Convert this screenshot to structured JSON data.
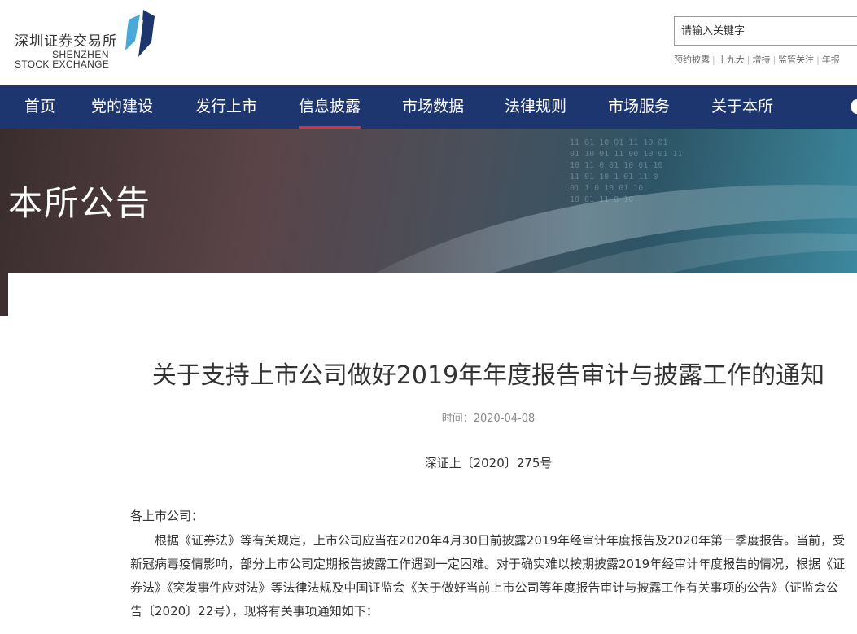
{
  "header": {
    "logo_cn": "深圳证券交易所",
    "logo_en_1": "SHENZHEN",
    "logo_en_2": "STOCK EXCHANGE",
    "search_placeholder": "请输入关键字",
    "quick_links": [
      "预约披露",
      "十九大",
      "增持",
      "监管关注",
      "年报"
    ]
  },
  "nav": {
    "items": [
      {
        "label": "首页"
      },
      {
        "label": "党的建设"
      },
      {
        "label": "发行上市"
      },
      {
        "label": "信息披露",
        "active": true
      },
      {
        "label": "市场数据"
      },
      {
        "label": "法律规则"
      },
      {
        "label": "市场服务"
      },
      {
        "label": "关于本所"
      }
    ]
  },
  "banner": {
    "title": "本所公告"
  },
  "article": {
    "title": "关于支持上市公司做好2019年年度报告审计与披露工作的通知",
    "time": "时间：2020-04-08",
    "doc_number": "深证上〔2020〕275号",
    "salutation": "各上市公司：",
    "paragraph": "根据《证券法》等有关规定，上市公司应当在2020年4月30日前披露2019年经审计年度报告及2020年第一季度报告。当前，受新冠病毒疫情影响，部分上市公司定期报告披露工作遇到一定困难。对于确实难以按期披露2019年经审计年度报告的情况，根据《证券法》《突发事件应对法》等法律法规及中国证监会《关于做好当前上市公司等年度报告审计与披露工作有关事项的公告》（证监会公告〔2020〕22号），现将有关事项通知如下："
  },
  "colors": {
    "nav_bg": "#1e3670",
    "nav_active_underline": "#d6323c",
    "logo_blue": "#1e3670",
    "logo_cyan": "#4aa8d8"
  }
}
